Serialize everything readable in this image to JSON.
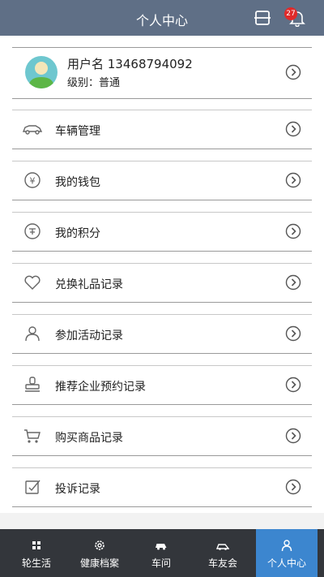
{
  "header": {
    "title": "个人中心",
    "notification_count": "27",
    "scan_icon": "scan-icon",
    "bell_icon": "bell-icon"
  },
  "profile": {
    "username": "用户名 13468794092",
    "level": "级别：普通"
  },
  "menu": [
    {
      "label": "车辆管理",
      "icon": "car-icon"
    },
    {
      "label": "我的钱包",
      "icon": "wallet-yen-icon"
    },
    {
      "label": "我的积分",
      "icon": "points-icon"
    },
    {
      "label": "兑换礼品记录",
      "icon": "heart-icon"
    },
    {
      "label": "参加活动记录",
      "icon": "person-icon"
    },
    {
      "label": "推荐企业预约记录",
      "icon": "stamp-icon"
    },
    {
      "label": "购买商品记录",
      "icon": "cart-icon"
    },
    {
      "label": "投诉记录",
      "icon": "complaint-edit-icon"
    }
  ],
  "tabs": [
    {
      "label": "轮生活",
      "icon": "grid-icon"
    },
    {
      "label": "健康档案",
      "icon": "gear-icon"
    },
    {
      "label": "车问",
      "icon": "car-question-icon"
    },
    {
      "label": "车友会",
      "icon": "car-club-icon"
    },
    {
      "label": "个人中心",
      "icon": "user-icon",
      "active": true
    }
  ],
  "colors": {
    "header": "#5f6f86",
    "tabbar": "#33363b",
    "active_tab": "#3c86cf",
    "badge": "#e02a2a",
    "icon_gray": "#666666"
  }
}
